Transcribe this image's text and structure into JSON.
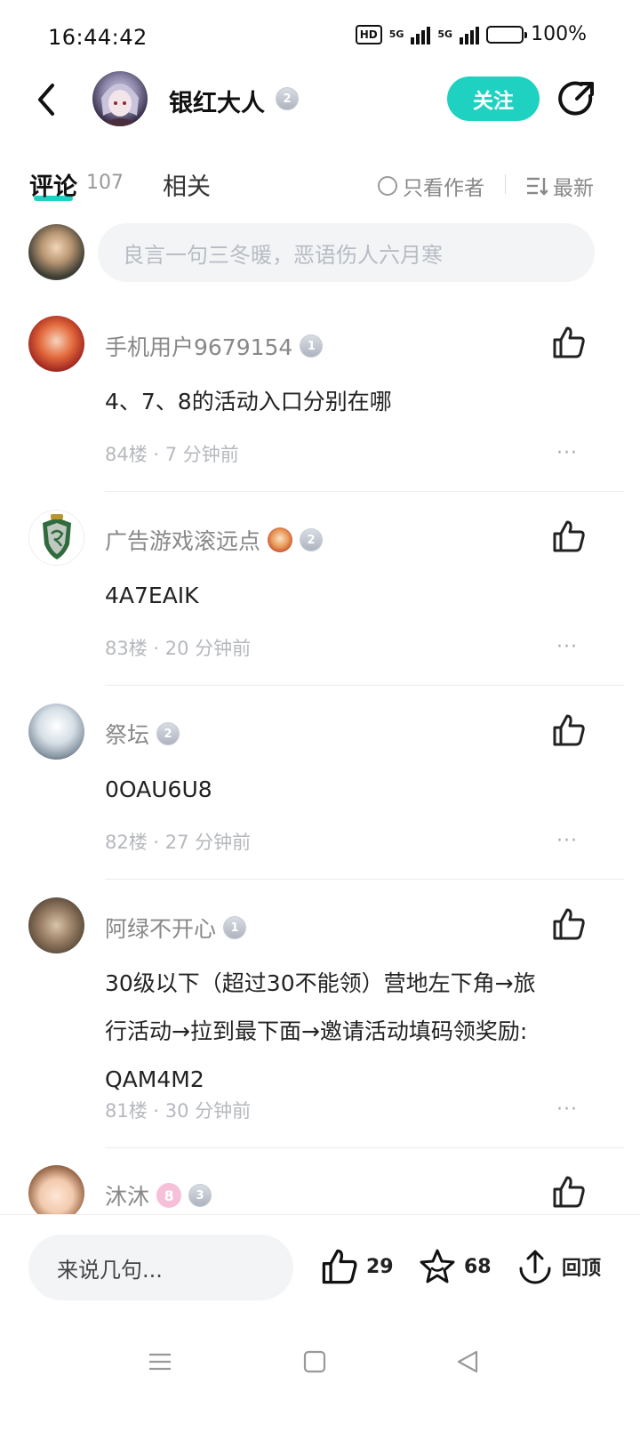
{
  "status_bar": {
    "time": "16:44:42",
    "hd_badge": "HD",
    "net1": "5G",
    "net2": "5G",
    "battery": "100%"
  },
  "header": {
    "username": "银红大人",
    "level": "2",
    "follow_label": "关注"
  },
  "tabs": {
    "comments_label": "评论",
    "comments_count": "107",
    "related_label": "相关",
    "only_author_label": "只看作者",
    "sort_label": "最新"
  },
  "compose": {
    "placeholder": "良言一句三冬暖，恶语伤人六月寒"
  },
  "comments": [
    {
      "name": "手机用户9679154",
      "level": "1",
      "text": "4、7、8的活动入口分别在哪",
      "meta": "84楼 · 7 分钟前"
    },
    {
      "name": "广告游戏滚远点",
      "level": "2",
      "text": "4A7EAIK",
      "meta": "83楼 · 20 分钟前"
    },
    {
      "name": "祭坛",
      "level": "2",
      "text": "0OAU6U8",
      "meta": "82楼 · 27 分钟前"
    },
    {
      "name": "阿绿不开心",
      "level": "1",
      "text_lines": [
        "30级以下（超过30不能领）营地左下角→旅",
        "行活动→拉到最下面→邀请活动填码领奖励:",
        "QAM4M2"
      ],
      "meta": "81楼 · 30 分钟前"
    },
    {
      "name": "沐沐",
      "fan_level": "8",
      "level": "3"
    }
  ],
  "more_label": "···",
  "bottom_bar": {
    "reply_placeholder": "来说几句...",
    "likes": "29",
    "favorites": "68",
    "back_to_top": "回顶"
  },
  "colors": {
    "accent": "#1fd1c0",
    "meta_text": "#b5b8bd"
  }
}
